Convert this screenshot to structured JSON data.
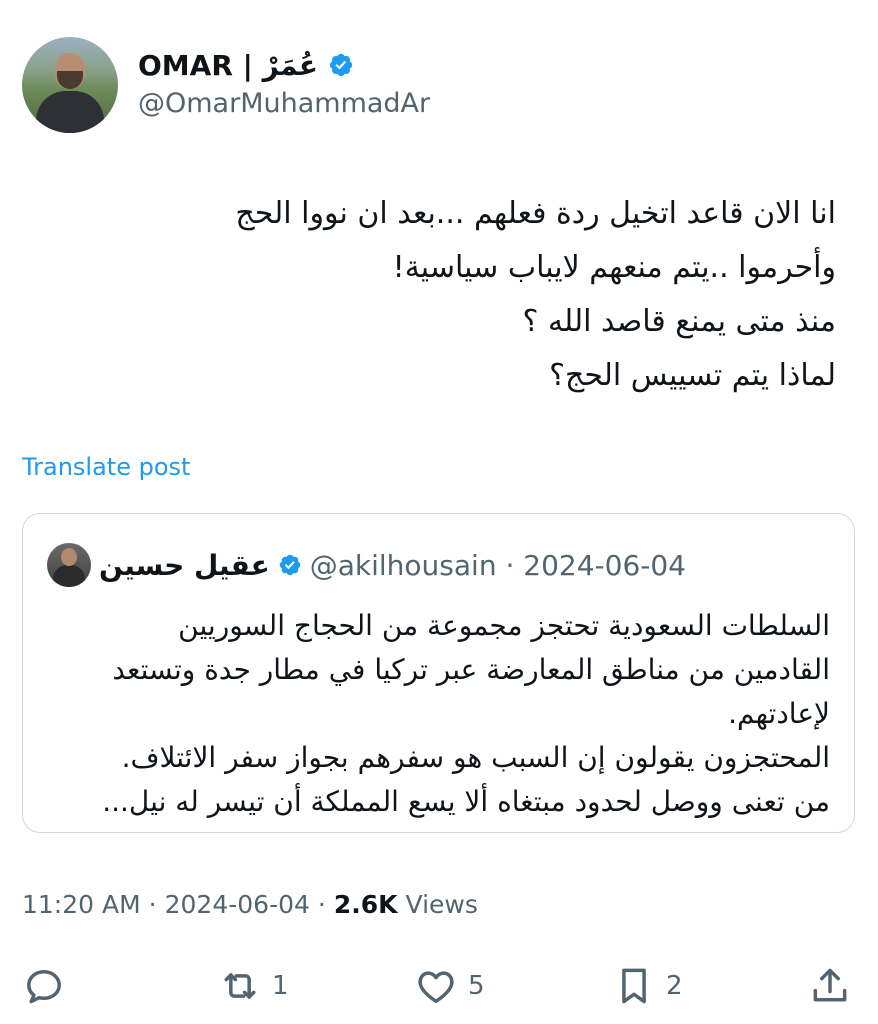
{
  "author": {
    "name": "OMAR | عُمَرْ",
    "handle": "@OmarMuhammadAr",
    "verified": true
  },
  "tweet": {
    "lines": [
      "انا الان قاعد اتخيل ردة فعلهم ...بعد ان نووا الحج",
      "وأحرموا ..يتم منعهم لايباب سياسية!",
      "منذ متى يمنع قاصد الله ؟",
      "لماذا يتم تسييس الحج؟"
    ],
    "translate_label": "Translate post"
  },
  "quote": {
    "name": "عقيل حسين",
    "verified": true,
    "meta": "@akilhousain · 2024-06-04",
    "lines": [
      "السلطات السعودية تحتجز مجموعة من الحجاج السوريين",
      "القادمين من مناطق المعارضة عبر تركيا في مطار جدة وتستعد",
      "لإعادتهم.",
      "المحتجزون يقولون إن السبب هو سفرهم بجواز سفر الائتلاف.",
      "من تعنى ووصل لحدود مبتغاه ألا يسع المملكة أن تيسر له نيل..."
    ]
  },
  "meta": {
    "time": "11:20 AM",
    "sep1": "·",
    "date": "2024-06-04",
    "sep2": "·",
    "views_count": "2.6K",
    "views_label": "Views"
  },
  "actions": {
    "reply_count": "",
    "retweet_count": "1",
    "like_count": "5",
    "bookmark_count": "2"
  },
  "colors": {
    "accent": "#1d9bf0",
    "text": "#0f1419",
    "muted": "#536471",
    "border": "#cfd9de"
  },
  "icons": [
    "verified-badge-icon",
    "reply-icon",
    "retweet-icon",
    "like-icon",
    "bookmark-icon",
    "share-icon"
  ]
}
